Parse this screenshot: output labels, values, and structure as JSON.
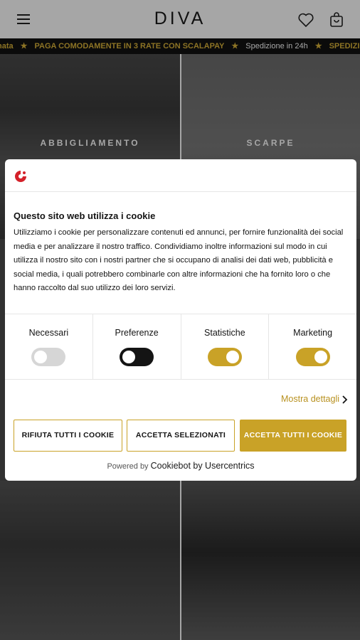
{
  "header": {
    "logo": "DIVA",
    "icons": [
      "menu-icon",
      "heart-icon",
      "shopping-bag-icon"
    ]
  },
  "ticker": {
    "items": [
      {
        "text": "nata",
        "style": "y"
      },
      {
        "text": "PAGA COMODAMENTE IN 3 RATE CON SCALAPAY",
        "style": "y"
      },
      {
        "text": "Spedizione in 24h",
        "style": "w"
      },
      {
        "text": "SPEDIZIONE GR",
        "style": "y"
      }
    ]
  },
  "tiles": {
    "clothing_label": "ABBIGLIAMENTO",
    "shoes_label": "SCARPE"
  },
  "cookie_dialog": {
    "title": "Questo sito web utilizza i cookie",
    "body": "Utilizziamo i cookie per personalizzare contenuti ed annunci, per fornire funzionalità dei social media e per analizzare il nostro traffico. Condividiamo inoltre informazioni sul modo in cui utilizza il nostro sito con i nostri partner che si occupano di analisi dei dati web, pubblicità e social media, i quali potrebbero combinarle con altre informazioni che ha fornito loro o che hanno raccolto dal suo utilizzo dei loro servizi.",
    "toggles": [
      {
        "label": "Necessari",
        "state": "on-disabled"
      },
      {
        "label": "Preferenze",
        "state": "off"
      },
      {
        "label": "Statistiche",
        "state": "on"
      },
      {
        "label": "Marketing",
        "state": "on"
      }
    ],
    "details_link": "Mostra dettagli",
    "buttons": {
      "reject": "RIFIUTA TUTTI I COOKIE",
      "accept_selected": "ACCETTA SELEZIONATI",
      "accept_all": "ACCETTA TUTTI I COOKIE"
    },
    "powered_prefix": "Powered by",
    "powered_brand": "Cookiebot by Usercentrics"
  },
  "colors": {
    "accent_gold": "#c9a227",
    "dark": "#141414"
  }
}
